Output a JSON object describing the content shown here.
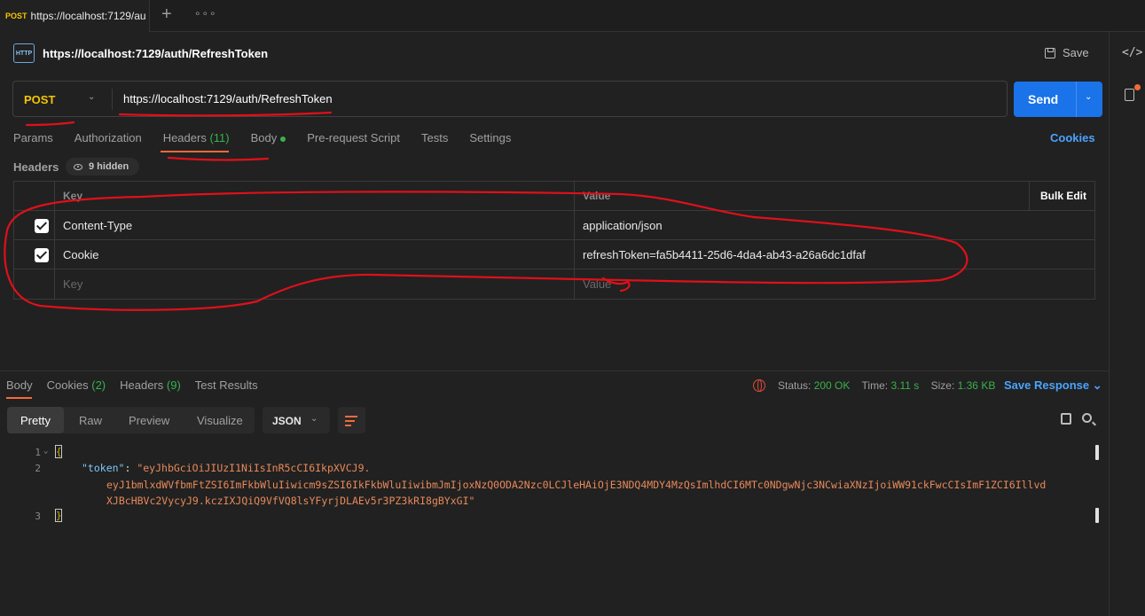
{
  "tabbar": {
    "active_tab": {
      "method": "POST",
      "url": "https://localhost:7129/au"
    },
    "new_tab_glyph": "+",
    "more_glyph": "∘∘∘"
  },
  "request": {
    "icon_label": "HTTP",
    "title": "https://localhost:7129/auth/RefreshToken",
    "save_label": "Save",
    "method": "POST",
    "url": "https://localhost:7129/auth/RefreshToken",
    "send_label": "Send",
    "tabs": {
      "params": "Params",
      "authorization": "Authorization",
      "headers": "Headers",
      "headers_count": "(11)",
      "body": "Body",
      "prerequest": "Pre-request Script",
      "tests": "Tests",
      "settings": "Settings"
    },
    "cookies_link": "Cookies"
  },
  "headers": {
    "label": "Headers",
    "hidden": "9 hidden",
    "columns": {
      "key": "Key",
      "value": "Value",
      "bulk_edit": "Bulk Edit"
    },
    "rows": [
      {
        "key": "Content-Type",
        "value": "application/json",
        "checked": true
      },
      {
        "key": "Cookie",
        "value": "refreshToken=fa5b4411-25d6-4da4-ab43-a26a6dc1dfaf",
        "checked": true
      }
    ],
    "placeholder": {
      "key": "Key",
      "value": "Value"
    }
  },
  "response": {
    "tabs": {
      "body": "Body",
      "cookies": "Cookies",
      "cookies_count": "(2)",
      "headers": "Headers",
      "headers_count": "(9)",
      "tests": "Test Results"
    },
    "status": {
      "status_label": "Status:",
      "status_value": "200 OK",
      "time_label": "Time:",
      "time_value": "3.11 s",
      "size_label": "Size:",
      "size_value": "1.36 KB"
    },
    "save_response": "Save Response",
    "format_tabs": {
      "pretty": "Pretty",
      "raw": "Raw",
      "preview": "Preview",
      "visualize": "Visualize"
    },
    "language": "JSON",
    "lines": [
      "1",
      "2",
      "3"
    ],
    "code": {
      "open_brace": "{",
      "close_brace": "}",
      "token_key": "\"token\"",
      "colon": ": ",
      "token_part1": "\"eyJhbGciOiJIUzI1NiIsInR5cCI6IkpXVCJ9.",
      "token_part2": "eyJ1bmlxdWVfbmFtZSI6ImFkbWluIiwicm9sZSI6IkFkbWluIiwibmJmIjoxNzQ0ODA2Nzc0LCJleHAiOjE3NDQ4MDY4MzQsImlhdCI6MTc0NDgwNjc3NCwiaXNzIjoiWW91ckFwcCIsImF1ZCI6Illvd",
      "token_part3": "XJBcHBVc2VycyJ9.kczIXJQiQ9VfVQ8lsYFyrjDLAEv5r3PZ3kRI8gBYxGI\""
    }
  },
  "colors": {
    "accent_orange": "#f26b3a",
    "method_yellow": "#f5c400",
    "send_blue": "#1a73e8",
    "success_green": "#37b24d",
    "annotation_red": "#e0101a"
  },
  "icons": [
    "http-icon",
    "save-icon",
    "chevron-down-icon",
    "eye-icon",
    "checkbox-icon",
    "globe-icon",
    "copy-icon",
    "search-icon",
    "wrap-icon",
    "code-icon",
    "document-icon"
  ]
}
